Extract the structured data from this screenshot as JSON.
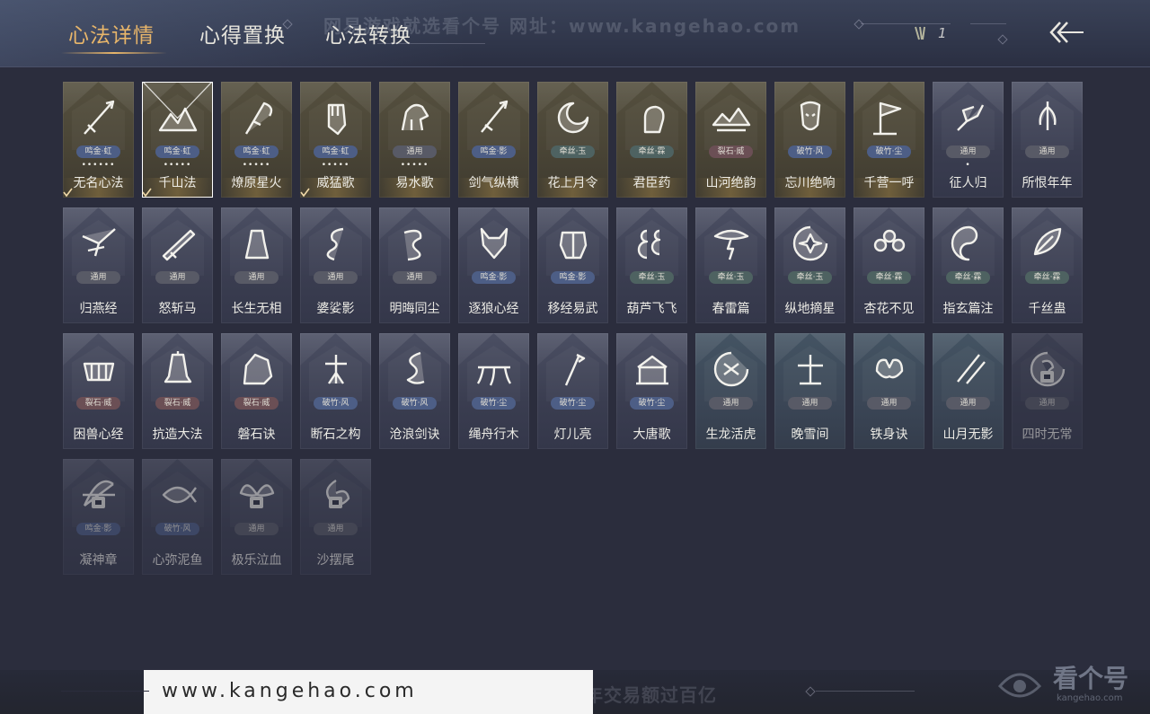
{
  "header": {
    "tabs": [
      {
        "label": "心法详情",
        "active": true
      },
      {
        "label": "心得置换",
        "active": false
      },
      {
        "label": "心法转换",
        "active": false
      }
    ],
    "watermark": "网易游戏就选看个号   网址：www.kangehao.com",
    "counter_value": "1",
    "back_icon": "double-chevron-left-icon"
  },
  "colors": {
    "accent_gold": "#e7b56a",
    "background": "#2b2d3d"
  },
  "cards": [
    {
      "name": "无名心法",
      "tag": "鸣金·虹",
      "tag_style": "t-blue",
      "dots": "••••••",
      "style": "gold",
      "checked": true,
      "icon": "spear-icon"
    },
    {
      "name": "千山法",
      "tag": "鸣金·虹",
      "tag_style": "t-blue",
      "dots": "•••••",
      "style": "gold",
      "checked": true,
      "selected": true,
      "icon": "mountain-icon"
    },
    {
      "name": "燎原星火",
      "tag": "鸣金·虹",
      "tag_style": "t-blue",
      "dots": "•••••",
      "style": "gold",
      "checked": false,
      "icon": "scythe-icon"
    },
    {
      "name": "威猛歌",
      "tag": "鸣金·虹",
      "tag_style": "t-blue",
      "dots": "•••••",
      "style": "gold",
      "checked": true,
      "icon": "fist-icon"
    },
    {
      "name": "易水歌",
      "tag": "通用",
      "tag_style": "t-gray",
      "dots": "•••••",
      "style": "gold",
      "icon": "horse-icon"
    },
    {
      "name": "剑气纵横",
      "tag": "鸣金·影",
      "tag_style": "t-blue",
      "dots": "",
      "style": "gold",
      "icon": "sword-icon"
    },
    {
      "name": "花上月令",
      "tag": "牵丝·玉",
      "tag_style": "t-green",
      "dots": "",
      "style": "gold",
      "icon": "flower-moon-icon"
    },
    {
      "name": "君臣药",
      "tag": "牵丝·霖",
      "tag_style": "t-green",
      "dots": "",
      "style": "gold",
      "icon": "medicine-icon"
    },
    {
      "name": "山河绝韵",
      "tag": "裂石·威",
      "tag_style": "t-red",
      "dots": "",
      "style": "gold",
      "icon": "landscape-icon"
    },
    {
      "name": "忘川绝响",
      "tag": "破竹·风",
      "tag_style": "t-blue",
      "dots": "",
      "style": "gold",
      "icon": "mask-icon"
    },
    {
      "name": "千营一呼",
      "tag": "破竹·尘",
      "tag_style": "t-blue",
      "dots": "",
      "style": "gold",
      "icon": "flag-icon"
    },
    {
      "name": "征人归",
      "tag": "通用",
      "tag_style": "t-gray",
      "dots": "•",
      "style": "plain",
      "icon": "bird-hand-icon"
    },
    {
      "name": "所恨年年",
      "tag": "通用",
      "tag_style": "t-gray",
      "dots": "",
      "style": "plain",
      "icon": "willow-icon"
    },
    {
      "name": "归燕经",
      "tag": "通用",
      "tag_style": "t-gray",
      "style": "plain",
      "icon": "swallow-icon"
    },
    {
      "name": "怒斩马",
      "tag": "通用",
      "tag_style": "t-gray",
      "style": "plain",
      "icon": "blade-icon"
    },
    {
      "name": "长生无相",
      "tag": "通用",
      "tag_style": "t-gray",
      "style": "plain",
      "icon": "statue-icon"
    },
    {
      "name": "婆娑影",
      "tag": "通用",
      "tag_style": "t-gray",
      "style": "plain",
      "icon": "dragon-icon"
    },
    {
      "name": "明晦同尘",
      "tag": "通用",
      "tag_style": "t-gray",
      "style": "plain",
      "icon": "snake-icon"
    },
    {
      "name": "逐狼心经",
      "tag": "鸣金·影",
      "tag_style": "t-blue",
      "style": "plain",
      "icon": "wolf-icon"
    },
    {
      "name": "移经易武",
      "tag": "鸣金·影",
      "tag_style": "t-blue",
      "style": "plain",
      "icon": "armor-icon"
    },
    {
      "name": "葫芦飞飞",
      "tag": "牵丝·玉",
      "tag_style": "t-green",
      "style": "plain",
      "icon": "gourd-icon"
    },
    {
      "name": "春雷篇",
      "tag": "牵丝·玉",
      "tag_style": "t-green",
      "style": "plain",
      "icon": "thunder-tree-icon"
    },
    {
      "name": "纵地摘星",
      "tag": "牵丝·玉",
      "tag_style": "t-green",
      "style": "plain",
      "icon": "star-orbit-icon"
    },
    {
      "name": "杏花不见",
      "tag": "牵丝·霖",
      "tag_style": "t-green",
      "style": "plain",
      "icon": "blossom-icon"
    },
    {
      "name": "指玄篇注",
      "tag": "牵丝·霖",
      "tag_style": "t-green",
      "style": "plain",
      "icon": "yinyang-icon"
    },
    {
      "name": "千丝蛊",
      "tag": "牵丝·霖",
      "tag_style": "t-green",
      "style": "plain",
      "icon": "leaf-icon"
    },
    {
      "name": "困兽心经",
      "tag": "裂石·威",
      "tag_style": "t-red",
      "style": "plain",
      "icon": "trap-icon"
    },
    {
      "name": "抗造大法",
      "tag": "裂石·威",
      "tag_style": "t-red",
      "style": "plain",
      "icon": "bell-icon"
    },
    {
      "name": "磐石诀",
      "tag": "裂石·威",
      "tag_style": "t-red",
      "style": "plain",
      "icon": "rock-icon"
    },
    {
      "name": "断石之构",
      "tag": "破竹·风",
      "tag_style": "t-blue",
      "style": "plain",
      "icon": "warrior-icon"
    },
    {
      "name": "沧浪剑诀",
      "tag": "破竹·风",
      "tag_style": "t-blue",
      "style": "plain",
      "icon": "water-dragon-icon"
    },
    {
      "name": "绳舟行木",
      "tag": "破竹·尘",
      "tag_style": "t-blue",
      "style": "plain",
      "icon": "roots-icon"
    },
    {
      "name": "灯儿亮",
      "tag": "破竹·尘",
      "tag_style": "t-blue",
      "style": "plain",
      "icon": "torch-icon"
    },
    {
      "name": "大唐歌",
      "tag": "破竹·尘",
      "tag_style": "t-blue",
      "style": "plain",
      "icon": "palace-icon"
    },
    {
      "name": "生龙活虎",
      "tag": "通用",
      "tag_style": "t-gray",
      "style": "teal",
      "icon": "swirl-icon"
    },
    {
      "name": "晚雪间",
      "tag": "通用",
      "tag_style": "t-gray",
      "style": "teal",
      "icon": "cross-icon"
    },
    {
      "name": "铁身诀",
      "tag": "通用",
      "tag_style": "t-gray",
      "style": "teal",
      "icon": "muscle-icon"
    },
    {
      "name": "山月无影",
      "tag": "通用",
      "tag_style": "t-gray",
      "style": "teal",
      "icon": "moon-slash-icon"
    },
    {
      "name": "四时无常",
      "tag": "通用",
      "tag_style": "t-gray",
      "style": "faded",
      "locked": true,
      "icon": "seasons-icon"
    },
    {
      "name": "凝神章",
      "tag": "鸣金·影",
      "tag_style": "t-blue",
      "style": "faded",
      "locked": true,
      "icon": "bow-icon"
    },
    {
      "name": "心弥泥鱼",
      "tag": "破竹·风",
      "tag_style": "t-blue",
      "style": "faded",
      "locked": false,
      "icon": "fish-icon"
    },
    {
      "name": "极乐泣血",
      "tag": "通用",
      "tag_style": "t-gray",
      "style": "faded",
      "locked": true,
      "icon": "wings-icon"
    },
    {
      "name": "沙摆尾",
      "tag": "通用",
      "tag_style": "t-gray",
      "style": "faded",
      "locked": true,
      "icon": "tail-icon"
    }
  ],
  "footer": {
    "watermark": "看个号专业网易游戏八年  年交易额过百亿",
    "url": "www.kangehao.com",
    "logo_text": "看个号",
    "logo_sub": "kangehao.com"
  }
}
